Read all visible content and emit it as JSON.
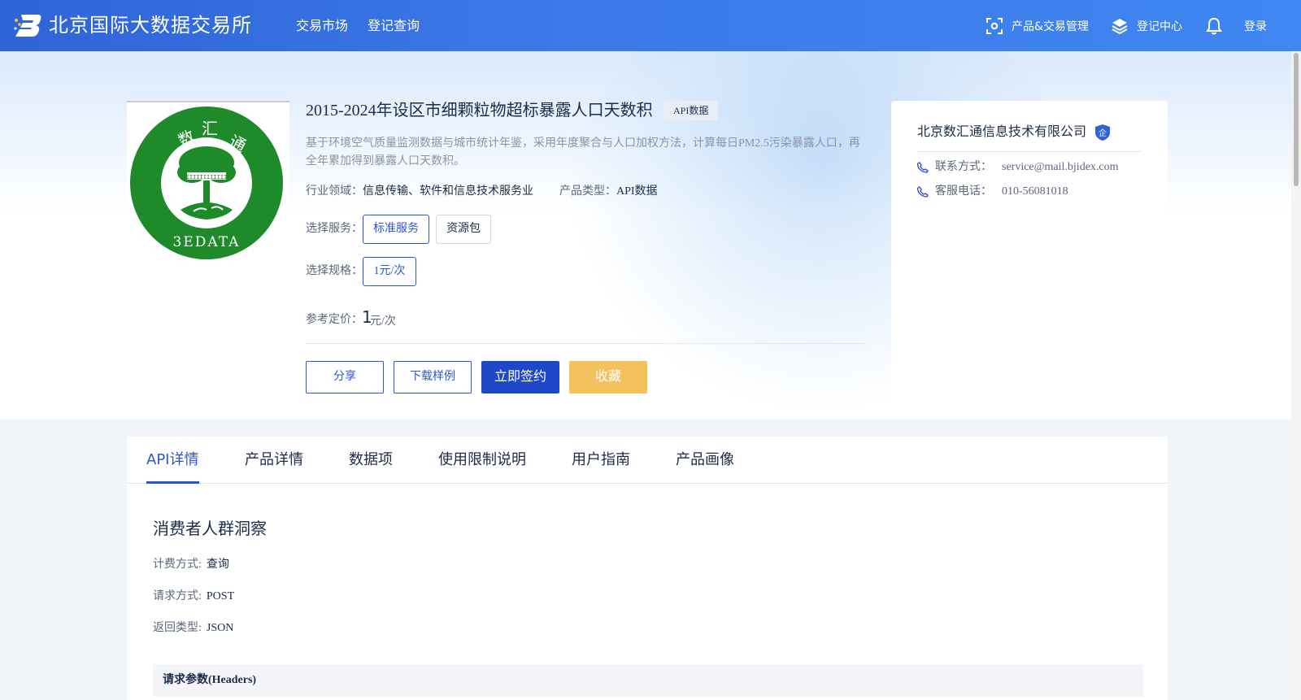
{
  "nav": {
    "brand": "北京国际大数据交易所",
    "links": [
      "交易市场",
      "登记查询"
    ],
    "right": {
      "product_mgmt": "产品&交易管理",
      "registry_center": "登记中心",
      "login": "登录"
    }
  },
  "product": {
    "title": "2015-2024年设区市细颗粒物超标暴露人口天数积",
    "tag": "API数据",
    "description": "基于环境空气质量监测数据与城市统计年鉴，采用年度聚合与人口加权方法，计算每日PM2.5污染暴露人口，再全年累加得到暴露人口天数积。",
    "logo_text": {
      "top": "数 汇 通",
      "bottom": "3EDATA"
    },
    "industry_label": "行业领域：",
    "industry_value": "信息传输、软件和信息技术服务业",
    "type_label": "产品类型：",
    "type_value": "API数据",
    "service_label": "选择服务：",
    "services": [
      "标准服务",
      "资源包"
    ],
    "spec_label": "选择规格：",
    "specs": [
      "1元/次"
    ],
    "price_label": "参考定价：",
    "price_value": "1",
    "price_unit": "元/次",
    "actions": {
      "share": "分享",
      "download_sample": "下载样例",
      "sign_now": "立即签约",
      "favorite": "收藏"
    }
  },
  "seller": {
    "name": "北京数汇通信息技术有限公司",
    "badge": "企",
    "contact_label": "联系方式：",
    "contact_value": "service@mail.bjidex.com",
    "phone_label": "客服电话：",
    "phone_value": "010-56081018"
  },
  "tabs": [
    "API详情",
    "产品详情",
    "数据项",
    "使用限制说明",
    "用户指南",
    "产品画像"
  ],
  "api_detail": {
    "section_title": "消费者人群洞察",
    "billing_label": "计费方式:",
    "billing_value": "查询",
    "method_label": "请求方式:",
    "method_value": "POST",
    "return_label": "返回类型:",
    "return_value": "JSON",
    "params_header": "请求参数(Headers)"
  },
  "colors": {
    "nav_gradient_start": "#2f64d6",
    "nav_gradient_end": "#3f86f0",
    "primary": "#1e48c8",
    "accent_blue": "#2f56c9",
    "favorite": "#f3c25e",
    "logo_green": "#1f8a2a"
  }
}
